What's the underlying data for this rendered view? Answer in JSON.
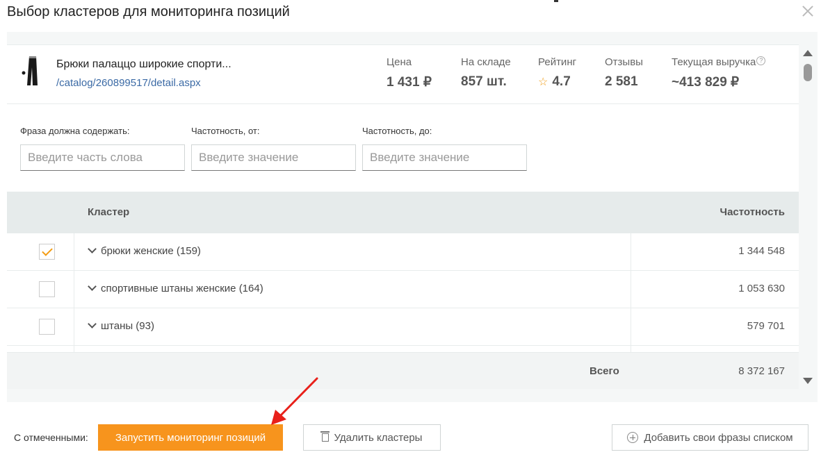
{
  "modal": {
    "title": "Выбор кластеров для мониторинга позиций"
  },
  "product": {
    "name": "Брюки палаццо широкие спорти...",
    "link": "/catalog/260899517/detail.aspx",
    "stats": {
      "price_label": "Цена",
      "price_value": "1 431 ₽",
      "stock_label": "На складе",
      "stock_value": "857 шт.",
      "rating_label": "Рейтинг",
      "rating_value": "4.7",
      "reviews_label": "Отзывы",
      "reviews_value": "2 581",
      "revenue_label": "Текущая выручка",
      "revenue_value": "~413 829 ₽",
      "help_glyph": "?"
    }
  },
  "filters": {
    "phrase_label": "Фраза должна содержать:",
    "phrase_placeholder": "Введите часть слова",
    "freq_from_label": "Частотность, от:",
    "freq_from_placeholder": "Введите значение",
    "freq_to_label": "Частотность, до:",
    "freq_to_placeholder": "Введите значение"
  },
  "table": {
    "col_cluster": "Кластер",
    "col_frequency": "Частотность",
    "rows": [
      {
        "name": "брюки женские (159)",
        "frequency": "1 344 548",
        "checked": true
      },
      {
        "name": "спортивные штаны женские (164)",
        "frequency": "1 053 630",
        "checked": false
      },
      {
        "name": "штаны (93)",
        "frequency": "579 701",
        "checked": false
      }
    ],
    "total_label": "Всего",
    "total_value": "8 372 167"
  },
  "footer": {
    "with_selected_label": "С отмеченными:",
    "start_button": "Запустить мониторинг позиций",
    "delete_button": "Удалить кластеры",
    "add_button": "Добавить свои фразы списком"
  },
  "colors": {
    "accent": "#f7941d",
    "link": "#3b6aa5",
    "check": "#f39c12",
    "annotation_arrow": "#e8201a"
  }
}
